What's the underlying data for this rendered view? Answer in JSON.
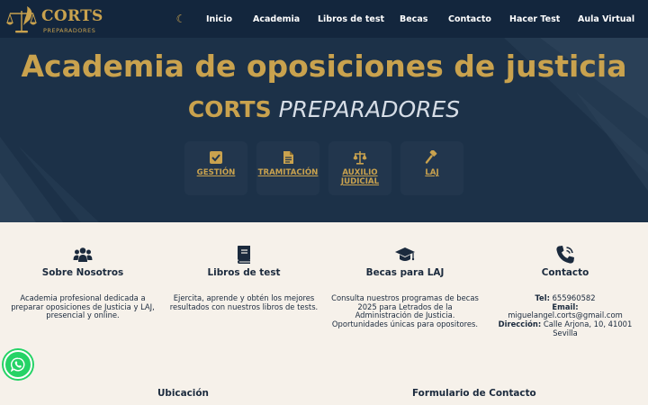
{
  "colors": {
    "navy": "#13263d",
    "gold": "#c9a24e",
    "cream": "#f6f1ea",
    "whatsapp": "#25d366"
  },
  "brand": {
    "name": "CORTS",
    "tagline": "PREPARADORES",
    "logo_icon": "scales-quill-icon"
  },
  "nav": {
    "theme_toggle_icon": "moon-icon",
    "links": [
      "Inicio",
      "Academia",
      "Libros de test",
      "Becas",
      "Contacto",
      "Hacer Test",
      "Aula Virtual"
    ]
  },
  "hero": {
    "title": "Academia de oposiciones de justicia",
    "subtitle_bold": "CORTS",
    "subtitle_italic": "PREPARADORES",
    "tiles": [
      {
        "label": "GESTIÓN",
        "icon": "check-square-icon"
      },
      {
        "label": "TRAMITACIÓN",
        "icon": "document-icon"
      },
      {
        "label": "AUXILIO JUDICIAL",
        "icon": "scales-icon"
      },
      {
        "label": "LAJ",
        "icon": "gavel-icon"
      }
    ]
  },
  "features": [
    {
      "title": "Sobre Nosotros",
      "icon": "users-icon",
      "text": "Academia profesional dedicada a preparar oposiciones de Justicia y LAJ, presencial y online."
    },
    {
      "title": "Libros de test",
      "icon": "book-icon",
      "text": "Ejercita, aprende y obtén los mejores resultados con nuestros libros de tests."
    },
    {
      "title": "Becas para LAJ",
      "icon": "graduation-cap-icon",
      "text": "Consulta nuestros programas de becas 2025 para Letrados de la Administración de Justicia. Oportunidades únicas para opositores."
    }
  ],
  "contact": {
    "title": "Contacto",
    "icon": "phone-icon",
    "tel_label": "Tel:",
    "tel": "655960582",
    "email_label": "Email:",
    "email": "miguelangel.corts@gmail.com",
    "address_label": "Dirección:",
    "address": "Calle Arjona, 10, 41001 Sevilla"
  },
  "bottom": {
    "location_title": "Ubicación",
    "form_title": "Formulario de Contacto"
  },
  "whatsapp_icon": "whatsapp-icon"
}
